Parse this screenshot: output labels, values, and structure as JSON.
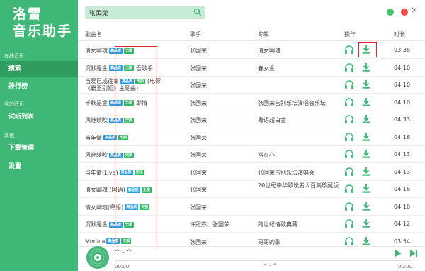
{
  "app": {
    "logo_line1": "洛雪",
    "logo_line2": "音乐助手"
  },
  "sidebar": {
    "section_online": "在线音乐",
    "item_search": "搜索",
    "item_charts": "排行榜",
    "section_my": "我的音乐",
    "item_playlist": "试听列表",
    "section_other": "其他",
    "item_downloads": "下载管理",
    "item_settings": "设置"
  },
  "search": {
    "value": "张国荣",
    "icon": "search-icon"
  },
  "window": {
    "close_label": "×"
  },
  "table": {
    "headers": {
      "name": "歌曲名",
      "artist": "歌手",
      "album": "专辑",
      "ops": "操作",
      "duration": "时长"
    },
    "tag_hq": "高品质",
    "tag_lossless": "无损",
    "rows": [
      {
        "name": "倩女幽魂",
        "tags": [
          "hq",
          "ls"
        ],
        "artist": "张国荣",
        "album": "倩女幽魂",
        "duration": "03:38"
      },
      {
        "name": "沉默是金",
        "tags": [
          "hq",
          "ls"
        ],
        "extra": "吾歌手",
        "artist": "张国荣",
        "album": "春女金",
        "duration": "04:10"
      },
      {
        "name": "当爱已成往事",
        "extra": "(电影《霸王别姬》主题曲)",
        "tags": [
          "hq",
          "ls"
        ],
        "artist": "张国荣",
        "album": "",
        "duration": "04:10"
      },
      {
        "name": "千秋是金",
        "extra": "即情",
        "tags": [
          "hq",
          "ls"
        ],
        "artist": "张国荣",
        "album": "张国荣告别乐坛演唱会乐坛",
        "duration": "04:10"
      },
      {
        "name": "风继续吹",
        "tags": [
          "hq",
          "ls"
        ],
        "artist": "张国荣",
        "album": "粤语超白金",
        "duration": "04:33"
      },
      {
        "name": "当年情",
        "tags": [
          "hq",
          "ls"
        ],
        "artist": "张国荣",
        "album": "",
        "duration": "04:16"
      },
      {
        "name": "风继续吹",
        "tags": [
          "hq",
          "ls"
        ],
        "artist": "张国荣",
        "album": "常在心",
        "duration": "04:13"
      },
      {
        "name": "当年情(Live)",
        "tags": [
          "hq",
          "ls"
        ],
        "artist": "张国荣",
        "album": "张国荣告别乐坛演唱会",
        "duration": "04:13"
      },
      {
        "name": "倩女幽魂 (国语)",
        "tags": [
          "hq",
          "ls"
        ],
        "artist": "张国荣",
        "album": "20世纪中华歌坛名人百集珍藏版",
        "duration": "04:16"
      },
      {
        "name": "倩女幽魂(粤语)",
        "tags": [
          "hq",
          "ls"
        ],
        "artist": "张国荣",
        "album": "",
        "duration": "04:10"
      },
      {
        "name": "沉默是金",
        "tags": [
          "hq",
          "ls"
        ],
        "artist": "许冠杰、张国荣",
        "album": "跨世纪情歌典藏",
        "duration": "04:12"
      },
      {
        "name": "Monica",
        "tags": [
          "hq",
          "ls"
        ],
        "artist": "张国荣",
        "album": "哥哥的歌",
        "duration": "03:54"
      }
    ]
  },
  "player": {
    "title": "^ - ^",
    "time_current": "00:00",
    "time_total": "00:00",
    "center": "^ - ^"
  },
  "colors": {
    "accent": "#3fb776",
    "accent_dark": "#2f9c60",
    "highlight_box": "#e12626",
    "tag_hq": "#2a9de2",
    "tag_lossless": "#2fba66"
  }
}
